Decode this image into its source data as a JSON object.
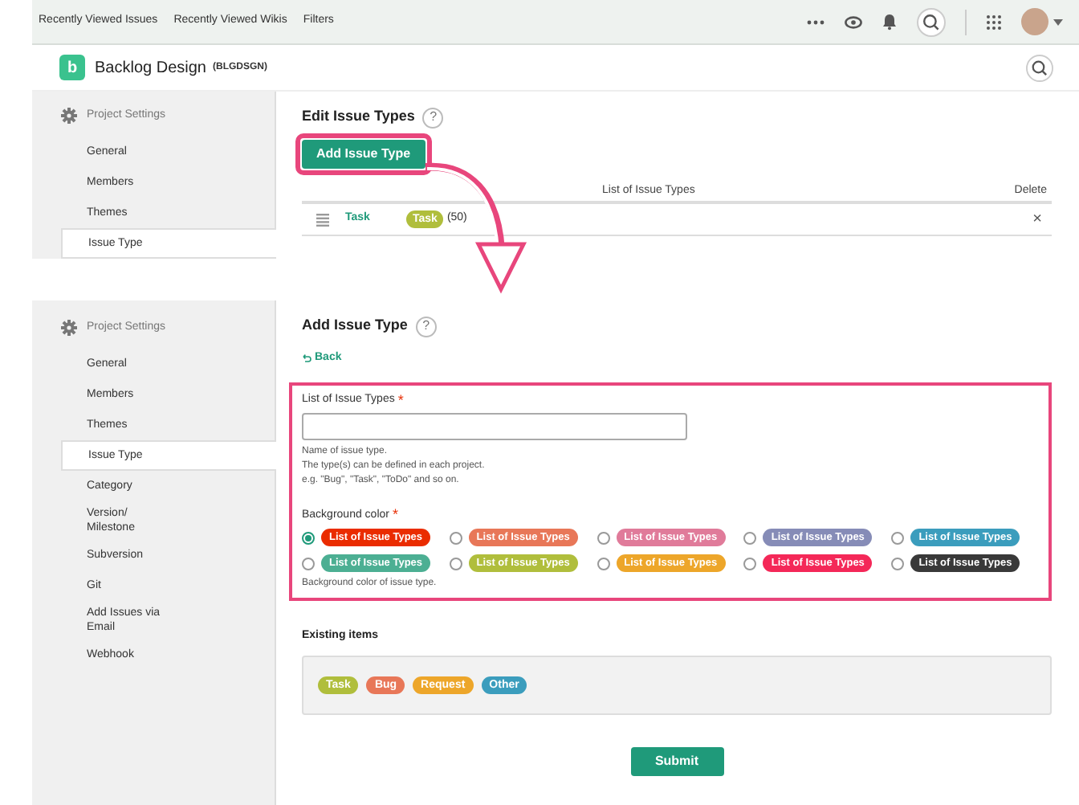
{
  "top_nav": {
    "links": [
      "Recently Viewed Issues",
      "Recently Viewed Wikis",
      "Filters"
    ]
  },
  "project": {
    "logo": "b",
    "name": "Backlog Design",
    "key": "(BLGDSGN)"
  },
  "edit_panel": {
    "sidebar": {
      "heading": "Project Settings",
      "items": [
        {
          "label": "General",
          "selected": false
        },
        {
          "label": "Members",
          "selected": false
        },
        {
          "label": "Themes",
          "selected": false
        },
        {
          "label": "Issue Type",
          "selected": true
        }
      ]
    },
    "title": "Edit Issue Types",
    "help": "?",
    "add_button": "Add Issue Type",
    "table": {
      "columns": [
        "List of Issue Types",
        "Delete"
      ],
      "rows": [
        {
          "name": "Task",
          "badge": "Task",
          "color": "#b0be3c",
          "count": "(50)",
          "delete": "×"
        }
      ]
    }
  },
  "add_panel": {
    "sidebar": {
      "heading": "Project Settings",
      "items": [
        {
          "label": "General",
          "selected": false
        },
        {
          "label": "Members",
          "selected": false
        },
        {
          "label": "Themes",
          "selected": false
        },
        {
          "label": "Issue Type",
          "selected": true
        },
        {
          "label": "Category",
          "selected": false
        },
        {
          "label": "Version/ Milestone",
          "selected": false
        },
        {
          "label": "Subversion",
          "selected": false
        },
        {
          "label": "Git",
          "selected": false
        },
        {
          "label": "Add Issues via Email",
          "selected": false
        },
        {
          "label": "Webhook",
          "selected": false
        }
      ]
    },
    "title": "Add Issue Type",
    "help": "?",
    "back": "Back",
    "name_field": {
      "label": "List of Issue Types",
      "required_mark": "*",
      "hints": [
        "Name of issue type.",
        "The type(s) can be defined in each project.",
        "e.g. \"Bug\", \"Task\", \"ToDo\" and so on."
      ]
    },
    "color_field": {
      "label": "Background color",
      "required_mark": "*",
      "options": [
        {
          "label": "List of Issue Types",
          "color": "#ea2c00",
          "selected": true
        },
        {
          "label": "List of Issue Types",
          "color": "#e87758",
          "selected": false
        },
        {
          "label": "List of Issue Types",
          "color": "#e07b9a",
          "selected": false
        },
        {
          "label": "List of Issue Types",
          "color": "#868cb7",
          "selected": false
        },
        {
          "label": "List of Issue Types",
          "color": "#3b9dbd",
          "selected": false
        },
        {
          "label": "List of Issue Types",
          "color": "#4caf93",
          "selected": false
        },
        {
          "label": "List of Issue Types",
          "color": "#b0be3c",
          "selected": false
        },
        {
          "label": "List of Issue Types",
          "color": "#eda62a",
          "selected": false
        },
        {
          "label": "List of Issue Types",
          "color": "#f42858",
          "selected": false
        },
        {
          "label": "List of Issue Types",
          "color": "#393939",
          "selected": false
        }
      ],
      "hint": "Background color of issue type."
    },
    "existing": {
      "title": "Existing items",
      "items": [
        {
          "label": "Task",
          "color": "#b0be3c"
        },
        {
          "label": "Bug",
          "color": "#e87758"
        },
        {
          "label": "Request",
          "color": "#eda62a"
        },
        {
          "label": "Other",
          "color": "#3b9dbd"
        }
      ]
    },
    "submit": "Submit"
  }
}
